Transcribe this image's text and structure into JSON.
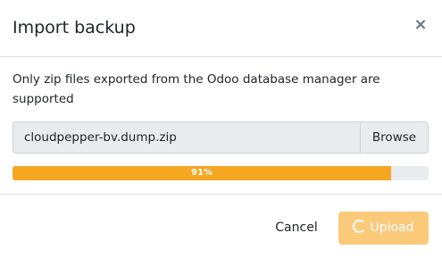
{
  "dialog": {
    "title": "Import backup",
    "close_glyph": "×",
    "description": "Only zip files exported from the Odoo database manager are supported"
  },
  "file_input": {
    "value": "cloudpepper-bv.dump.zip",
    "browse_label": "Browse"
  },
  "progress": {
    "percent": 91,
    "label": "91%",
    "color": "#f5a623"
  },
  "footer": {
    "cancel_label": "Cancel",
    "upload_label": "Upload",
    "upload_state": "loading",
    "upload_icon": "spinner-icon"
  },
  "colors": {
    "accent": "#f5a623",
    "upload_disabled": "#fbc97a"
  }
}
